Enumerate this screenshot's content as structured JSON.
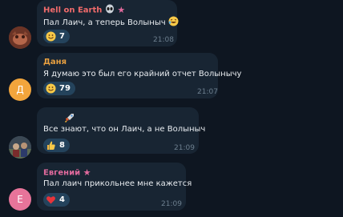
{
  "messages": [
    {
      "author": "Hell on Earth",
      "text": "Пал Лаич, а теперь Волыныч",
      "time": "21:08",
      "reaction_count": "7"
    },
    {
      "author": "Даня",
      "avatar_letter": "Д",
      "text": "Я думаю это был его крайний отчет Волынычу",
      "time": "21:07",
      "reaction_count": "79"
    },
    {
      "text": "Все знают, что он Лаич, а не Волыныч",
      "time": "21:09",
      "reaction_count": "8"
    },
    {
      "author": "Евгений",
      "avatar_letter": "Е",
      "text": "Пал лаич прикольнее мне кажется",
      "time": "21:09",
      "reaction_count": "4"
    }
  ],
  "colors": {
    "background": "#0e1621",
    "bubble": "#182533",
    "reaction_bg": "#24435c",
    "name_hell": "#f06b6b",
    "name_danya": "#e8a040",
    "name_evgeniy": "#e16a9d",
    "avatar_danya": "#f2a53c",
    "avatar_evgeniy": "#e7749a"
  }
}
